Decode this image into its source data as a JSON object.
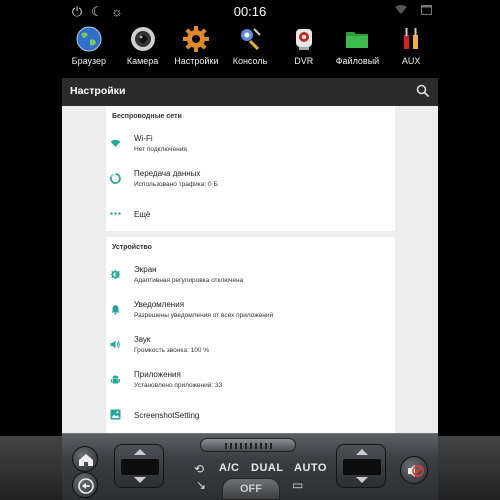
{
  "status_bar": {
    "time": "00:16",
    "left_icons": [
      "power-icon",
      "moon-icon",
      "brightness-icon"
    ],
    "right_icons": [
      "wifi-icon",
      "window-icon"
    ]
  },
  "launcher": {
    "apps": [
      {
        "label": "Браузер",
        "icon": "globe-icon"
      },
      {
        "label": "Камера",
        "icon": "camera-icon"
      },
      {
        "label": "Настройки",
        "icon": "gear-icon"
      },
      {
        "label": "Консоль",
        "icon": "console-icon"
      },
      {
        "label": "DVR",
        "icon": "dvr-icon"
      },
      {
        "label": "Файловый",
        "icon": "folder-icon"
      },
      {
        "label": "AUX",
        "icon": "aux-icon"
      }
    ]
  },
  "settings": {
    "title": "Настройки",
    "accent_color": "#26a69a",
    "sections": [
      {
        "header": "Беспроводные сети",
        "items": [
          {
            "title": "Wi-Fi",
            "subtitle": "Нет подключения",
            "icon": "wifi-icon"
          },
          {
            "title": "Передача данных",
            "subtitle": "Использовано трафика: 0 Б",
            "icon": "data-usage-icon"
          },
          {
            "title": "Ещё",
            "subtitle": "",
            "icon": "more-icon"
          }
        ]
      },
      {
        "header": "Устройство",
        "items": [
          {
            "title": "Экран",
            "subtitle": "Адаптивная регулировка отключена",
            "icon": "brightness-icon"
          },
          {
            "title": "Уведомления",
            "subtitle": "Разрешены уведомления от всех приложений",
            "icon": "bell-icon"
          },
          {
            "title": "Звук",
            "subtitle": "Громкость звонка: 100 %",
            "icon": "volume-icon"
          },
          {
            "title": "Приложения",
            "subtitle": "Установлено приложений: 33",
            "icon": "android-icon"
          },
          {
            "title": "ScreenshotSetting",
            "subtitle": "",
            "icon": "image-icon"
          }
        ]
      }
    ]
  },
  "climate": {
    "ac_label": "A/C",
    "dual_label": "DUAL",
    "auto_label": "AUTO",
    "off_label": "OFF"
  }
}
